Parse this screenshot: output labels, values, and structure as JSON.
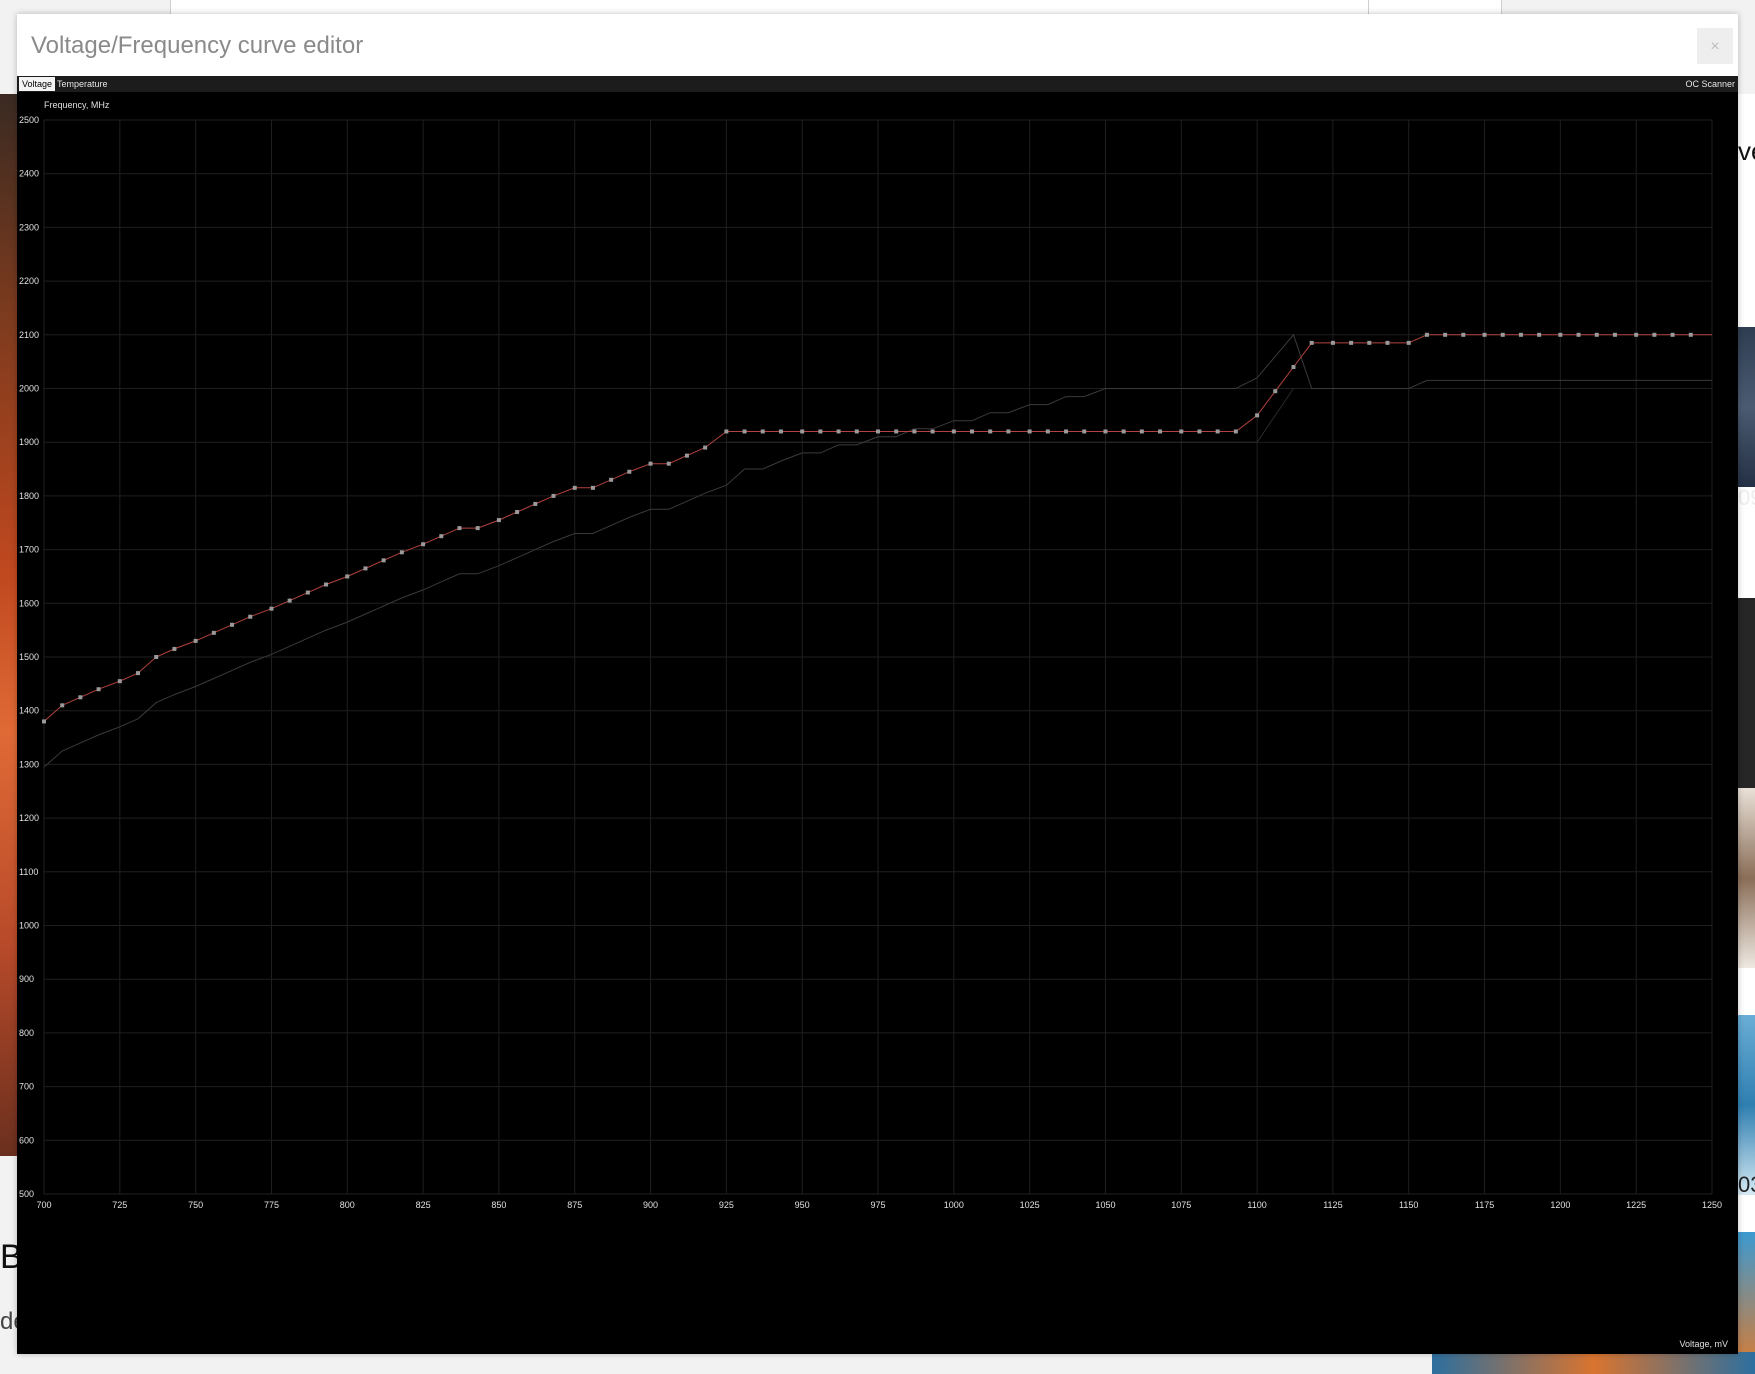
{
  "background": {
    "partial_text_right_1": "ve",
    "partial_text_right_2": "09",
    "partial_text_right_3": "03",
    "partial_text_left_1": "B",
    "partial_text_left_2": "de"
  },
  "dialog": {
    "title": "Voltage/Frequency curve editor",
    "close_label": "×",
    "tabs": [
      {
        "label": "Voltage",
        "active": true
      },
      {
        "label": "Temperature",
        "active": false
      }
    ],
    "oc_scanner_label": "OC Scanner"
  },
  "chart_data": {
    "type": "line",
    "ylabel": "Frequency, MHz",
    "xlabel": "Voltage, mV",
    "xlim": [
      700,
      1250
    ],
    "ylim": [
      500,
      2500
    ],
    "x_ticks": [
      700,
      725,
      750,
      775,
      800,
      825,
      850,
      875,
      900,
      925,
      950,
      975,
      1000,
      1025,
      1050,
      1075,
      1100,
      1125,
      1150,
      1175,
      1200,
      1225,
      1250
    ],
    "y_ticks": [
      500,
      600,
      700,
      800,
      900,
      1000,
      1100,
      1200,
      1300,
      1400,
      1500,
      1600,
      1700,
      1800,
      1900,
      2000,
      2100,
      2200,
      2300,
      2400,
      2500
    ],
    "grid": true,
    "colors": {
      "curve": "#b2433f",
      "point": "#9a9a9a",
      "default_curve": "#3a3a3a",
      "grid": "#1f1f1f",
      "text": "#e0e0e0"
    },
    "series": [
      {
        "role": "curve",
        "x": [
          700,
          706,
          712,
          718,
          725,
          731,
          737,
          743,
          750,
          756,
          762,
          768,
          775,
          781,
          787,
          793,
          800,
          806,
          812,
          818,
          825,
          831,
          837,
          843,
          850,
          856,
          862,
          868,
          875,
          881,
          887,
          893,
          900,
          906,
          912,
          918,
          925,
          931,
          937,
          943,
          950,
          956,
          962,
          968,
          975,
          981,
          987,
          993,
          1000,
          1006,
          1012,
          1018,
          1025,
          1031,
          1037,
          1043,
          1050,
          1056,
          1062,
          1068,
          1075,
          1081,
          1087,
          1093,
          1100,
          1106,
          1112,
          1118,
          1125,
          1131,
          1137,
          1143,
          1150,
          1156,
          1162,
          1168,
          1175,
          1181,
          1187,
          1193,
          1200,
          1206,
          1212,
          1218,
          1225,
          1231,
          1237,
          1243,
          1250
        ],
        "y": [
          1380,
          1410,
          1425,
          1440,
          1455,
          1470,
          1500,
          1515,
          1530,
          1545,
          1560,
          1575,
          1590,
          1605,
          1620,
          1635,
          1650,
          1665,
          1680,
          1695,
          1710,
          1725,
          1740,
          1740,
          1755,
          1770,
          1785,
          1800,
          1815,
          1815,
          1830,
          1845,
          1860,
          1860,
          1875,
          1890,
          1920,
          1920,
          1920,
          1920,
          1920,
          1920,
          1920,
          1920,
          1920,
          1920,
          1920,
          1920,
          1920,
          1920,
          1920,
          1920,
          1920,
          1920,
          1920,
          1920,
          1920,
          1920,
          1920,
          1920,
          1920,
          1920,
          1920,
          1920,
          1950,
          1995,
          2040,
          2085,
          2085,
          2085,
          2085,
          2085,
          2085,
          2100,
          2100,
          2100,
          2100,
          2100,
          2100,
          2100,
          2100,
          2100,
          2100,
          2100,
          2100,
          2100,
          2100,
          2100,
          2100
        ]
      },
      {
        "role": "default_curve",
        "x": [
          700,
          706,
          712,
          718,
          725,
          731,
          737,
          743,
          750,
          756,
          762,
          768,
          775,
          781,
          787,
          793,
          800,
          806,
          812,
          818,
          825,
          831,
          837,
          843,
          850,
          856,
          862,
          868,
          875,
          881,
          887,
          893,
          900,
          906,
          912,
          918,
          925,
          931,
          937,
          943,
          950,
          956,
          962,
          968,
          975,
          981,
          987,
          993,
          1000,
          1006,
          1012,
          1018,
          1025,
          1031,
          1037,
          1043,
          1050,
          1056,
          1062,
          1068,
          1075,
          1081,
          1087,
          1093,
          1100,
          1106,
          1112,
          1118,
          1125,
          1131,
          1137,
          1143,
          1150,
          1156,
          1162,
          1168,
          1175,
          1181,
          1187,
          1193,
          1200,
          1206,
          1212,
          1218,
          1225,
          1231,
          1237,
          1243,
          1250
        ],
        "y": [
          1295,
          1325,
          1340,
          1355,
          1370,
          1385,
          1415,
          1430,
          1445,
          1460,
          1475,
          1490,
          1505,
          1520,
          1535,
          1550,
          1565,
          1580,
          1595,
          1610,
          1625,
          1640,
          1655,
          1655,
          1670,
          1685,
          1700,
          1715,
          1730,
          1730,
          1745,
          1760,
          1775,
          1775,
          1790,
          1805,
          1820,
          1850,
          1850,
          1865,
          1880,
          1880,
          1895,
          1895,
          1910,
          1910,
          1925,
          1925,
          1940,
          1940,
          1955,
          1955,
          1970,
          1970,
          1985,
          1985,
          2000,
          2000,
          2000,
          2000,
          2000,
          2000,
          2000,
          2000,
          2020,
          2060,
          2100,
          2000,
          2000,
          2000,
          2000,
          2000,
          2000,
          2015,
          2015,
          2015,
          2015,
          2015,
          2015,
          2015,
          2015,
          2015,
          2015,
          2015,
          2015,
          2015,
          2015,
          2015,
          2015
        ]
      },
      {
        "role": "reference_line",
        "x": [
          925,
          1100,
          1112
        ],
        "y": [
          1900,
          1900,
          2000
        ]
      }
    ]
  }
}
